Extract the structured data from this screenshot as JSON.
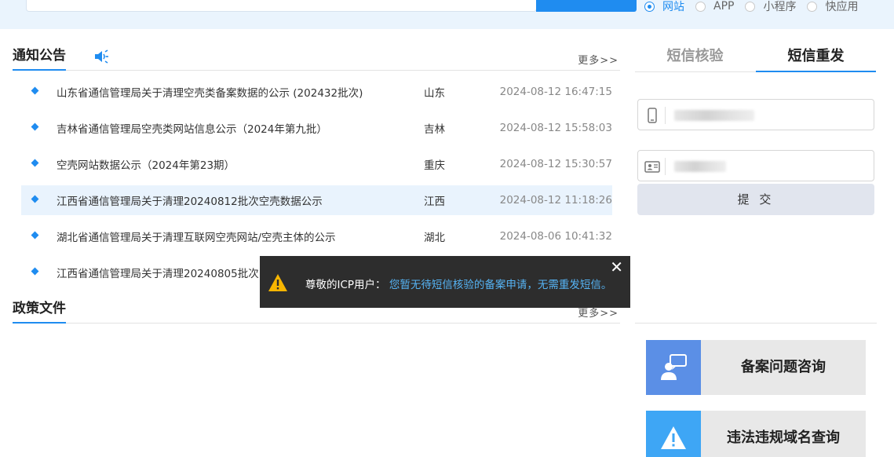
{
  "search": {
    "scope_options": [
      {
        "label": "网站",
        "checked": true
      },
      {
        "label": "APP",
        "checked": false
      },
      {
        "label": "小程序",
        "checked": false
      },
      {
        "label": "快应用",
        "checked": false
      }
    ]
  },
  "notices": {
    "title": "通知公告",
    "more": "更多>>",
    "items": [
      {
        "title": "山东省通信管理局关于清理空壳类备案数据的公示 (202432批次)",
        "region": "山东",
        "date": "2024-08-12 16:47:15"
      },
      {
        "title": "吉林省通信管理局空壳类网站信息公示（2024年第九批）",
        "region": "吉林",
        "date": "2024-08-12 15:58:03"
      },
      {
        "title": "空壳网站数据公示（2024年第23期）",
        "region": "重庆",
        "date": "2024-08-12 15:30:57"
      },
      {
        "title": "江西省通信管理局关于清理20240812批次空壳数据公示",
        "region": "江西",
        "date": "2024-08-12 11:18:26"
      },
      {
        "title": "湖北省通信管理局关于清理互联网空壳网站/空壳主体的公示",
        "region": "湖北",
        "date": "2024-08-06 10:41:32"
      },
      {
        "title": "江西省通信管理局关于清理20240805批次",
        "region": "",
        "date": ""
      }
    ]
  },
  "policy": {
    "title": "政策文件",
    "more": "更多>>"
  },
  "sms": {
    "tab_verify": "短信核验",
    "tab_resend": "短信重发",
    "submit": "提 交"
  },
  "cards": [
    {
      "label": "备案问题咨询",
      "color": "#5b8fe6",
      "icon": "consult-icon"
    },
    {
      "label": "违法违规域名查询",
      "color": "#3ea6f5",
      "icon": "warning-icon"
    }
  ],
  "toast": {
    "lead": "尊敬的ICP用户：",
    "body": "您暂无待短信核验的备案申请，无需重发短信。"
  }
}
